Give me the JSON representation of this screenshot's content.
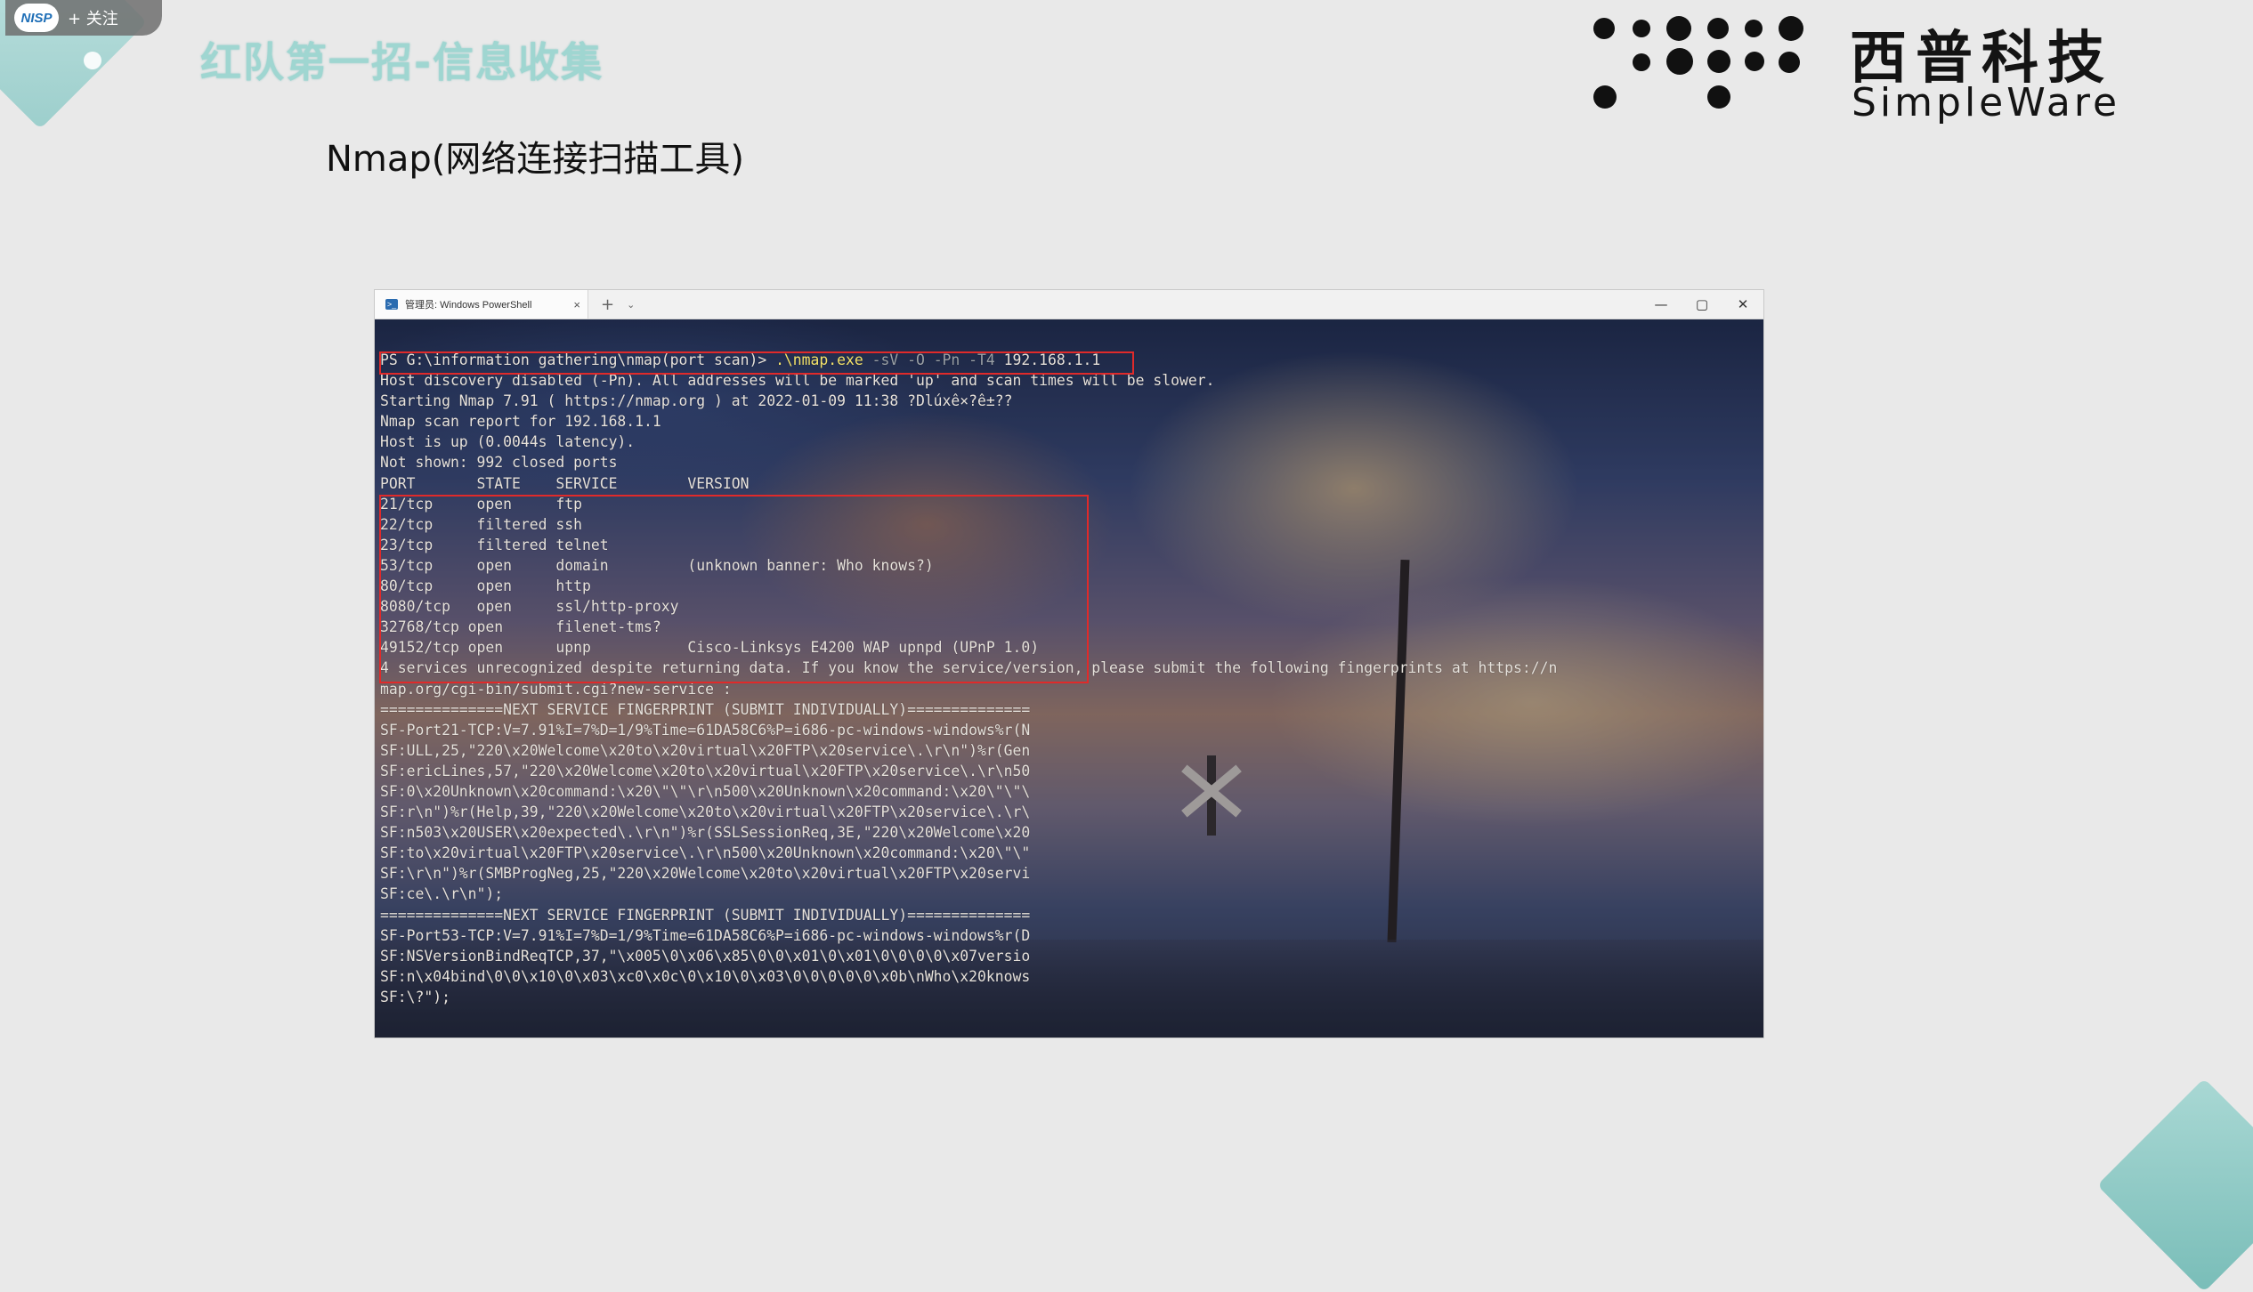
{
  "overlay": {
    "logo_text": "NISP",
    "follow_label": "+ 关注"
  },
  "slide": {
    "title": "红队第一招-信息收集",
    "subtitle": "Nmap(网络连接扫描工具)"
  },
  "brand": {
    "name_cn": "西普科技",
    "name_en": "SimpleWare"
  },
  "window": {
    "tab_icon": "powershell-icon",
    "tab_title": "管理员: Windows PowerShell",
    "tab_close": "×",
    "new_tab": "+",
    "dropdown": "⌄",
    "minimize": "—",
    "maximize": "▢",
    "close": "✕"
  },
  "terminal": {
    "prompt": "PS G:\\information gathering\\nmap(port scan)> ",
    "command": ".\\nmap.exe",
    "args": " -sV -O -Pn -T4",
    "target": " 192.168.1.1",
    "lines": [
      "Host discovery disabled (-Pn). All addresses will be marked 'up' and scan times will be slower.",
      "Starting Nmap 7.91 ( https://nmap.org ) at 2022-01-09 11:38 ?Dlúxê×?ê±??",
      "Nmap scan report for 192.168.1.1",
      "Host is up (0.0044s latency).",
      "Not shown: 992 closed ports",
      "PORT       STATE    SERVICE        VERSION",
      "21/tcp     open     ftp",
      "22/tcp     filtered ssh",
      "23/tcp     filtered telnet",
      "53/tcp     open     domain         (unknown banner: Who knows?)",
      "80/tcp     open     http",
      "8080/tcp   open     ssl/http-proxy",
      "32768/tcp open      filenet-tms?",
      "49152/tcp open      upnp           Cisco-Linksys E4200 WAP upnpd (UPnP 1.0)",
      "4 services unrecognized despite returning data. If you know the service/version, please submit the following fingerprints at https://n",
      "map.org/cgi-bin/submit.cgi?new-service :",
      "==============NEXT SERVICE FINGERPRINT (SUBMIT INDIVIDUALLY)==============",
      "SF-Port21-TCP:V=7.91%I=7%D=1/9%Time=61DA58C6%P=i686-pc-windows-windows%r(N",
      "SF:ULL,25,\"220\\x20Welcome\\x20to\\x20virtual\\x20FTP\\x20service\\.\\r\\n\")%r(Gen",
      "SF:ericLines,57,\"220\\x20Welcome\\x20to\\x20virtual\\x20FTP\\x20service\\.\\r\\n50",
      "SF:0\\x20Unknown\\x20command:\\x20\\\"\\\"\\r\\n500\\x20Unknown\\x20command:\\x20\\\"\\\"\\",
      "SF:r\\n\")%r(Help,39,\"220\\x20Welcome\\x20to\\x20virtual\\x20FTP\\x20service\\.\\r\\",
      "SF:n503\\x20USER\\x20expected\\.\\r\\n\")%r(SSLSessionReq,3E,\"220\\x20Welcome\\x20",
      "SF:to\\x20virtual\\x20FTP\\x20service\\.\\r\\n500\\x20Unknown\\x20command:\\x20\\\"\\\"",
      "SF:\\r\\n\")%r(SMBProgNeg,25,\"220\\x20Welcome\\x20to\\x20virtual\\x20FTP\\x20servi",
      "SF:ce\\.\\r\\n\");",
      "==============NEXT SERVICE FINGERPRINT (SUBMIT INDIVIDUALLY)==============",
      "SF-Port53-TCP:V=7.91%I=7%D=1/9%Time=61DA58C6%P=i686-pc-windows-windows%r(D",
      "SF:NSVersionBindReqTCP,37,\"\\x005\\0\\x06\\x85\\0\\0\\x01\\0\\x01\\0\\0\\0\\0\\x07versio",
      "SF:n\\x04bind\\0\\0\\x10\\0\\x03\\xc0\\x0c\\0\\x10\\0\\x03\\0\\0\\0\\0\\0\\x0b\\nWho\\x20knows",
      "SF:\\?\");"
    ]
  },
  "colors": {
    "title_teal": "#9fd6d1",
    "highlight_red": "#e02a2a",
    "command_yellow": "#f4e36c"
  }
}
